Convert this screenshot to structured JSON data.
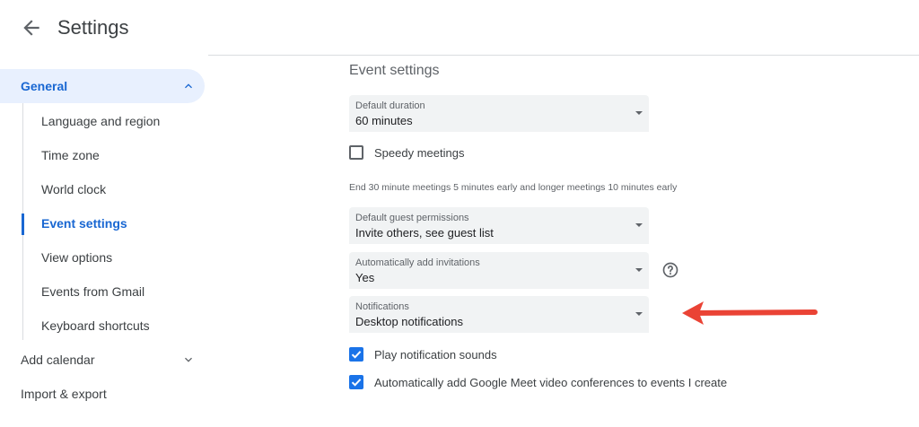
{
  "header": {
    "title": "Settings"
  },
  "sidebar": {
    "general_label": "General",
    "sub_items": [
      {
        "label": "Language and region"
      },
      {
        "label": "Time zone"
      },
      {
        "label": "World clock"
      },
      {
        "label": "Event settings"
      },
      {
        "label": "View options"
      },
      {
        "label": "Events from Gmail"
      },
      {
        "label": "Keyboard shortcuts"
      }
    ],
    "active_sub_item": "Event settings",
    "add_calendar_label": "Add calendar",
    "import_export_label": "Import & export"
  },
  "main": {
    "section_title": "Event settings",
    "default_duration": {
      "caption": "Default duration",
      "value": "60 minutes"
    },
    "speedy_meetings": {
      "label": "Speedy meetings",
      "checked": false
    },
    "speedy_hint": "End 30 minute meetings 5 minutes early and longer meetings 10 minutes early",
    "guest_permissions": {
      "caption": "Default guest permissions",
      "value": "Invite others, see guest list"
    },
    "auto_invitations": {
      "caption": "Automatically add invitations",
      "value": "Yes"
    },
    "notifications": {
      "caption": "Notifications",
      "value": "Desktop notifications"
    },
    "play_sounds": {
      "label": "Play notification sounds",
      "checked": true
    },
    "auto_meet": {
      "label": "Automatically add Google Meet video conferences to events I create",
      "checked": true
    }
  },
  "colors": {
    "accent": "#1967d2",
    "checkbox": "#1a73e8",
    "annotation_arrow": "#ea4335",
    "active_bg": "#e8f0fe"
  }
}
